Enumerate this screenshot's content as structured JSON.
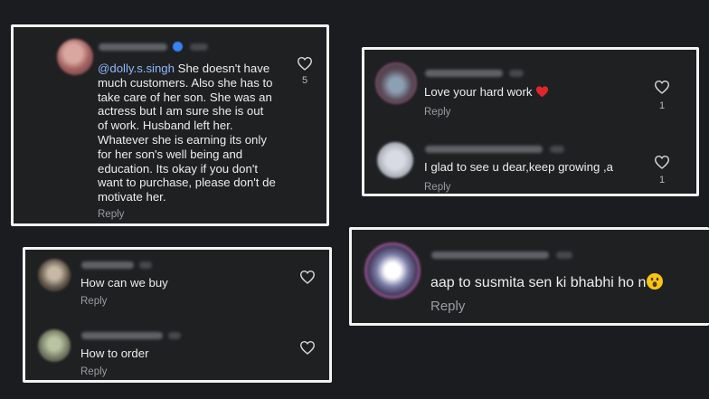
{
  "colors": {
    "background": "#1b1c1f",
    "card": "#1f2022",
    "frame": "#f2f2f2",
    "text": "#ededed",
    "mention": "#8fb8ff",
    "reply": "#9a9ca1",
    "heart_emoji": "#e0262a",
    "face_emoji": "#f5c518"
  },
  "comments": [
    {
      "mention": "@dolly.s.singh",
      "text_lines": [
        " She doesn't have",
        "much customers. Also she has to",
        "take care of her son. She was an",
        "actress but I am sure she is out",
        "of work. Husband left her.",
        "Whatever she is earning its only",
        "for her son's well being and",
        "education. Its okay if you don't",
        "want to purchase, please don't de",
        "motivate her."
      ],
      "reply_label": "Reply",
      "likes": "5",
      "verified_badge": "verified-icon"
    },
    {
      "text": "Love your hard work ",
      "emoji": "red-heart-emoji",
      "reply_label": "Reply",
      "likes": "1"
    },
    {
      "text": "I glad to see u dear,keep growing ,a",
      "reply_label": "Reply",
      "likes": "1"
    },
    {
      "text": "How can we buy",
      "reply_label": "Reply"
    },
    {
      "text": "How to order",
      "reply_label": "Reply"
    },
    {
      "text": "aap to susmita sen ki bhabhi ho n",
      "emoji": "astonished-face-emoji",
      "reply_label": "Reply"
    }
  ]
}
